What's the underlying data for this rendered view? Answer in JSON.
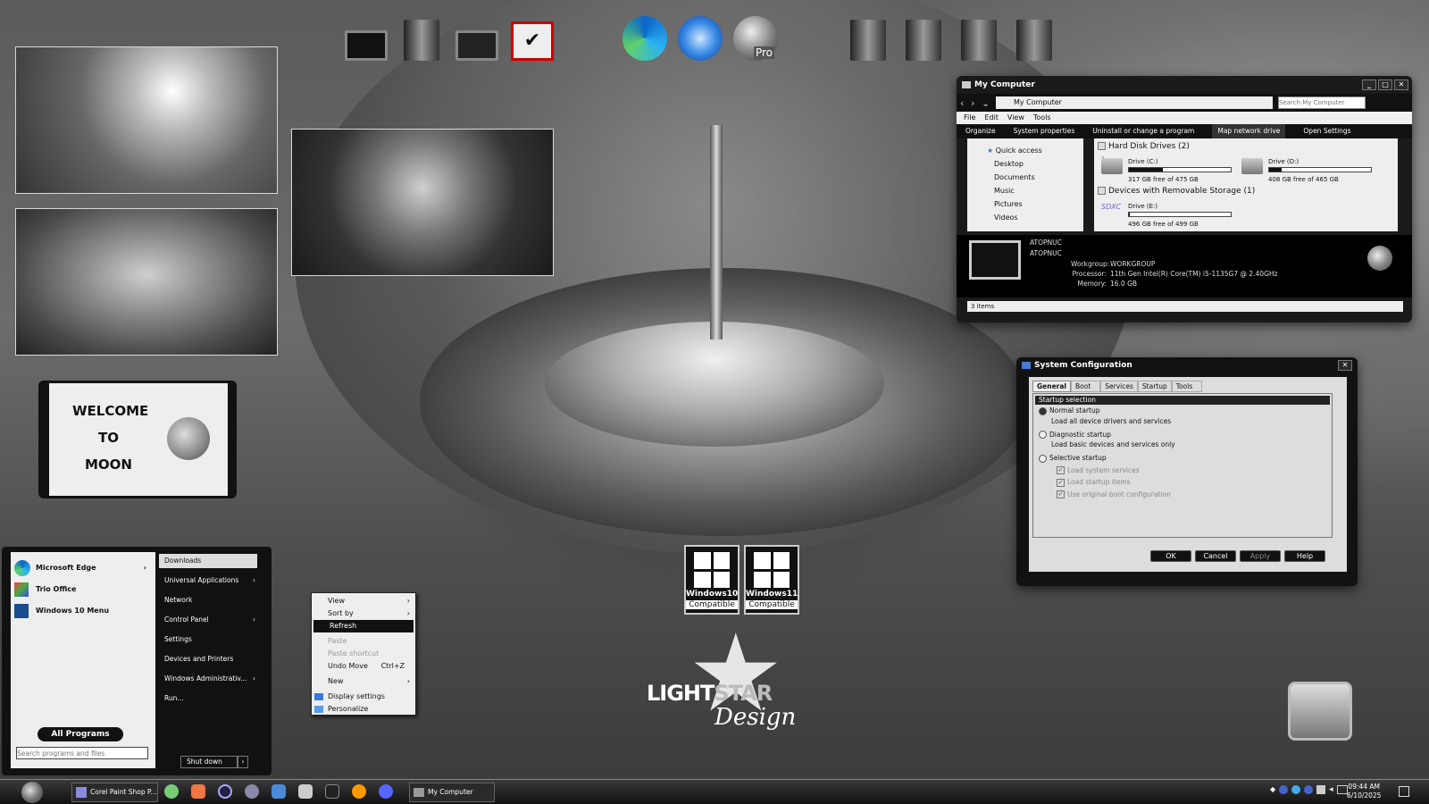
{
  "desktop": {
    "top_icons": [
      "monitor-icon",
      "folder-icon",
      "network-icon",
      "checklist-icon",
      "edge-icon",
      "thunderbird-icon",
      "earth-pro-icon",
      "folder-icon",
      "folder-icon",
      "folder-icon",
      "folder-icon"
    ],
    "earth_badge": "Pro",
    "welcome": {
      "line1": "WELCOME",
      "line2": "TO",
      "line3": "MOON"
    },
    "compat": [
      {
        "title": "Windows10",
        "label": "Compatible"
      },
      {
        "title": "Windows11",
        "label": "Compatible"
      }
    ],
    "logo": {
      "text1": "LIGHT",
      "text2": "STAR",
      "script": "Design"
    }
  },
  "mycomputer": {
    "title": "My Computer",
    "address": "My Computer",
    "search_placeholder": "Search My Computer",
    "menu": [
      "File",
      "Edit",
      "View",
      "Tools"
    ],
    "toolbar": [
      "Organize",
      "System properties",
      "Uninstall or change a program",
      "Map network drive",
      "Open Settings"
    ],
    "sidebar": [
      {
        "label": "Quick access"
      },
      {
        "label": "Desktop"
      },
      {
        "label": "Documents"
      },
      {
        "label": "Music"
      },
      {
        "label": "Pictures"
      },
      {
        "label": "Videos"
      }
    ],
    "group1": "Hard Disk Drives (2)",
    "group2": "Devices with Removable Storage (1)",
    "drives": [
      {
        "name": "Drive (C:)",
        "free": "317 GB free of 475 GB",
        "used_fraction": 0.33
      },
      {
        "name": "Drive (D:)",
        "free": "408 GB free of 465 GB",
        "used_fraction": 0.12
      },
      {
        "name": "Drive (E:)",
        "free": "496 GB free of 499 GB",
        "used_fraction": 0.01
      }
    ],
    "sdxc": "SDXC",
    "details": {
      "pc1": "ATOPNUC",
      "pc2": "ATOPNUC",
      "workgroup_label": "Workgroup:",
      "workgroup": "WORKGROUP",
      "processor_label": "Processor:",
      "processor": "11th Gen Intel(R) Core(TM) i5-1135G7 @ 2.40GHz",
      "memory_label": "Memory:",
      "memory": "16.0 GB"
    },
    "status": "3 items"
  },
  "sysconfig": {
    "title": "System Configuration",
    "tabs": [
      "General",
      "Boot",
      "Services",
      "Startup",
      "Tools"
    ],
    "section": "Startup selection",
    "normal": "Normal startup",
    "normal_desc": "Load all device drivers and services",
    "diag": "Diagnostic startup",
    "diag_desc": "Load basic devices and services only",
    "selective": "Selective startup",
    "opt1": "Load system services",
    "opt2": "Load startup items",
    "opt3": "Use original boot configuration",
    "buttons": [
      "OK",
      "Cancel",
      "Apply",
      "Help"
    ]
  },
  "context_menu": {
    "view": "View",
    "sortby": "Sort by",
    "refresh": "Refresh",
    "paste": "Paste",
    "paste_shortcut": "Paste shortcut",
    "undo": "Undo Move",
    "undo_key": "Ctrl+Z",
    "new": "New",
    "display": "Display settings",
    "personalize": "Personalize"
  },
  "start_menu": {
    "left": [
      "Microsoft Edge",
      "Trio Office",
      "Windows 10 Menu"
    ],
    "right": [
      "Downloads",
      "Universal Applications",
      "Network",
      "Control Panel",
      "Settings",
      "Devices and Printers",
      "Windows Administrativ...",
      "Run..."
    ],
    "all_programs": "All Programs",
    "search_placeholder": "Search programs and files",
    "shutdown": "Shut down"
  },
  "taskbar": {
    "app1": "Corel Paint Shop P...",
    "app2": "My Computer",
    "time": "09:44 AM",
    "date": "6/10/2025"
  }
}
